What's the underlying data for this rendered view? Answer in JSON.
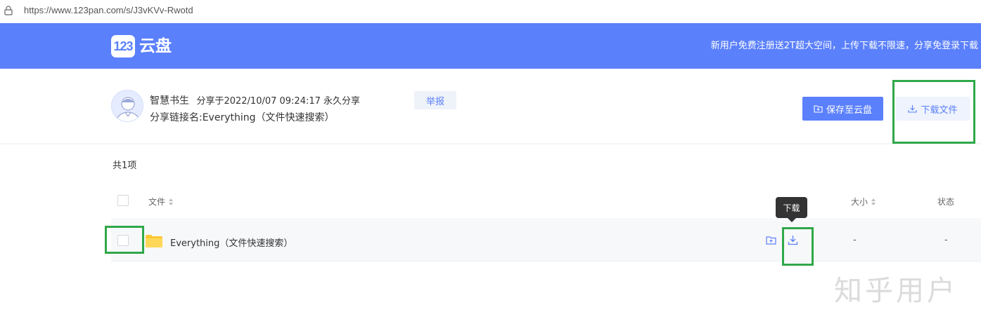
{
  "browser": {
    "url": "https://www.123pan.com/s/J3vKVv-Rwotd"
  },
  "banner": {
    "logo_mark": "123",
    "logo_text": "云盘",
    "promo_text": "新用户免费注册送2T超大空间，上传下载不限速，分享免登录下载",
    "brand_color": "#5b80fc"
  },
  "share": {
    "sharer_name": "智慧书生",
    "share_meta": "分享于2022/10/07 09:24:17 永久分享",
    "link_name": "分享链接名:Everything（文件快速搜索）",
    "report_label": "举报",
    "save_label": "保存至云盘",
    "download_label": "下载文件"
  },
  "list": {
    "count_label": "共1项",
    "columns": {
      "file": "文件",
      "size": "大小",
      "status": "状态"
    },
    "rows": [
      {
        "name": "Everything（文件快速搜索）",
        "size": "-",
        "status": "-"
      }
    ],
    "tooltip": "下载"
  },
  "watermark": "知乎用户",
  "highlight_color": "#2fa84a"
}
